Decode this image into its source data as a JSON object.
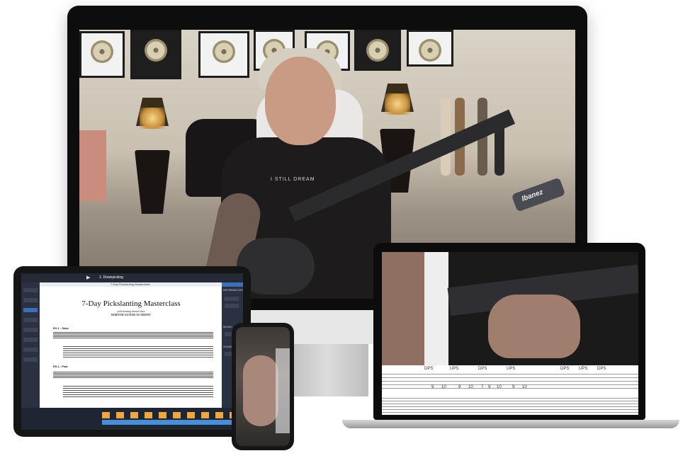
{
  "imac": {
    "guitar_brand": "Ibanez",
    "shirt_text": "I STILL DREAM"
  },
  "ipad": {
    "toolbar_song": "1. Downpicking",
    "score_title": "7-Day Pickslanting Masterclass",
    "score_subtitle": "pickslanting masterclass",
    "score_author": "BORNTH GUITAR ACADEMY",
    "header_strip": "7-Day Pickslanting Masterclass",
    "ex1": "EX.1 - Slow",
    "ex2": "EX.1 - Fast",
    "panel_info": "INFORMATION",
    "panel_music": "MUSIC",
    "panel_sound": "SOUND"
  },
  "laptop": {
    "tab_marks": [
      "DPS",
      "UPS",
      "DPS",
      "UPS",
      "DPS",
      "UPS",
      "DPS"
    ],
    "tab_numbers": [
      "9",
      "10",
      "9",
      "10",
      "7",
      "9",
      "10",
      "9",
      "10"
    ]
  },
  "colors": {
    "ipad_accent": "#f0a640",
    "laptop_highlight": "#fbf3ad"
  }
}
